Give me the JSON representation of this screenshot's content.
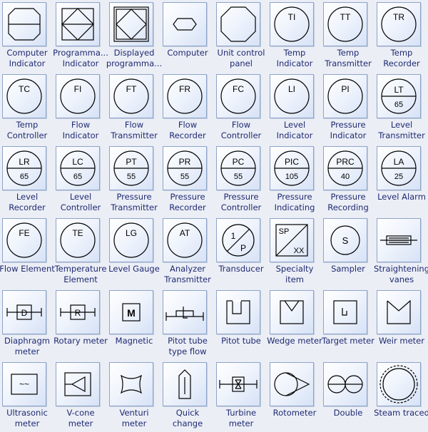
{
  "colors": {
    "tile_border": "#8ea3c9",
    "label": "#1f2a72",
    "stroke": "#000000"
  },
  "shapes": [
    {
      "label": "Computer\nIndicator",
      "icon": "computer-indicator"
    },
    {
      "label": "Programma...\nIndicator",
      "icon": "programmable-indicator"
    },
    {
      "label": "Displayed\nprogramma...",
      "icon": "displayed-programmable"
    },
    {
      "label": "Computer",
      "icon": "computer"
    },
    {
      "label": "Unit control\npanel",
      "icon": "unit-control-panel"
    },
    {
      "label": "Temp\nIndicator",
      "icon": "instrument-circle",
      "top": "TI"
    },
    {
      "label": "Temp\nTransmitter",
      "icon": "instrument-circle",
      "top": "TT"
    },
    {
      "label": "Temp\nRecorder",
      "icon": "instrument-circle",
      "top": "TR"
    },
    {
      "label": "Temp\nController",
      "icon": "instrument-circle",
      "top": "TC"
    },
    {
      "label": "Flow\nIndicator",
      "icon": "instrument-circle",
      "top": "FI"
    },
    {
      "label": "Flow\nTransmitter",
      "icon": "instrument-circle",
      "top": "FT"
    },
    {
      "label": "Flow\nRecorder",
      "icon": "instrument-circle",
      "top": "FR"
    },
    {
      "label": "Flow\nController",
      "icon": "instrument-circle",
      "top": "FC"
    },
    {
      "label": "Level\nIndicator",
      "icon": "instrument-circle",
      "top": "LI"
    },
    {
      "label": "Pressure\nIndicator",
      "icon": "instrument-circle",
      "top": "PI"
    },
    {
      "label": "Level\nTransmitter",
      "icon": "instrument-split",
      "top": "LT",
      "bottom": "65"
    },
    {
      "label": "Level\nRecorder",
      "icon": "instrument-split",
      "top": "LR",
      "bottom": "65"
    },
    {
      "label": "Level\nController",
      "icon": "instrument-split",
      "top": "LC",
      "bottom": "65"
    },
    {
      "label": "Pressure\nTransmitter",
      "icon": "instrument-split",
      "top": "PT",
      "bottom": "55"
    },
    {
      "label": "Pressure\nRecorder",
      "icon": "instrument-split",
      "top": "PR",
      "bottom": "55"
    },
    {
      "label": "Pressure\nController",
      "icon": "instrument-split",
      "top": "PC",
      "bottom": "55"
    },
    {
      "label": "Pressure\nIndicating",
      "icon": "instrument-split",
      "top": "PIC",
      "bottom": "105"
    },
    {
      "label": "Pressure\nRecording",
      "icon": "instrument-split",
      "top": "PRC",
      "bottom": "40"
    },
    {
      "label": "Level Alarm",
      "icon": "instrument-split",
      "top": "LA",
      "bottom": "25"
    },
    {
      "label": "Flow Element",
      "icon": "instrument-circle",
      "top": "FE"
    },
    {
      "label": "Temperature\nElement",
      "icon": "instrument-circle",
      "top": "TE"
    },
    {
      "label": "Level Gauge",
      "icon": "instrument-circle",
      "top": "LG"
    },
    {
      "label": "Analyzer\nTransmitter",
      "icon": "instrument-circle",
      "top": "AT"
    },
    {
      "label": "Transducer",
      "icon": "transducer",
      "top": "1",
      "bottom": "P"
    },
    {
      "label": "Specialty\nitem",
      "icon": "specialty",
      "top": "SP",
      "bottom": "XX"
    },
    {
      "label": "Sampler",
      "icon": "sampler",
      "top": "S"
    },
    {
      "label": "Straightening\nvanes",
      "icon": "straightening-vanes"
    },
    {
      "label": "Diaphragm\nmeter",
      "icon": "boxed-meter",
      "top": "D"
    },
    {
      "label": "Rotary meter",
      "icon": "boxed-meter",
      "top": "R"
    },
    {
      "label": "Magnetic",
      "icon": "magnetic",
      "top": "M"
    },
    {
      "label": "Pitot tube\ntype flow",
      "icon": "pitot-type-flow"
    },
    {
      "label": "Pitot tube",
      "icon": "pitot-tube"
    },
    {
      "label": "Wedge meter",
      "icon": "wedge-meter"
    },
    {
      "label": "Target meter",
      "icon": "target-meter"
    },
    {
      "label": "Weir meter",
      "icon": "weir-meter"
    },
    {
      "label": "Ultrasonic\nmeter",
      "icon": "ultrasonic-meter",
      "top": "~~"
    },
    {
      "label": "V-cone\nmeter",
      "icon": "v-cone-meter"
    },
    {
      "label": "Venturi\nmeter",
      "icon": "venturi-meter"
    },
    {
      "label": "Quick\nchange",
      "icon": "quick-change"
    },
    {
      "label": "Turbine\nmeter",
      "icon": "turbine-meter"
    },
    {
      "label": "Rotometer",
      "icon": "rotometer"
    },
    {
      "label": "Double",
      "icon": "double"
    },
    {
      "label": "Steam traced",
      "icon": "steam-traced"
    }
  ]
}
